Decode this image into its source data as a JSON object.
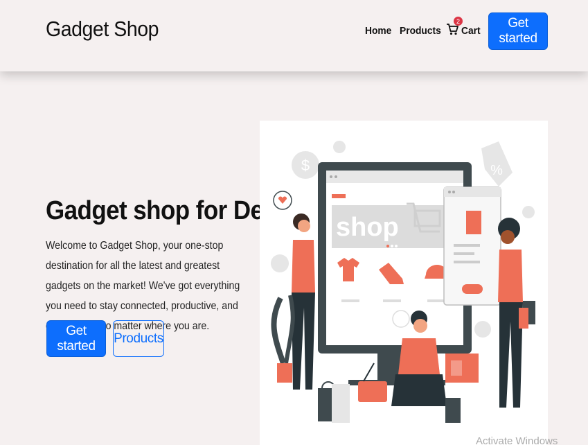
{
  "navbar": {
    "brand": "Gadget Shop",
    "links": [
      {
        "label": "Home"
      },
      {
        "label": "Products"
      }
    ],
    "cart": {
      "label": "Cart",
      "count": "2"
    },
    "cta_label": "Get started"
  },
  "hero": {
    "title": "Gadget shop for Devs",
    "description": "Welcome to Gadget Shop, your one-stop destination for all the latest and greatest gadgets on the market! We've got everything you need to stay connected, productive, and entertained, no matter where you are.",
    "primary_button": "Get started",
    "secondary_button": "Products",
    "illustration": {
      "headline": "shop"
    }
  },
  "overlay": {
    "watermark": "Activate Windows"
  },
  "colors": {
    "primary": "#0d6efd",
    "background": "#f5f0f0",
    "accent": "#ee6f57",
    "monitor": "#3f4a4e",
    "badge": "#dc3545"
  }
}
